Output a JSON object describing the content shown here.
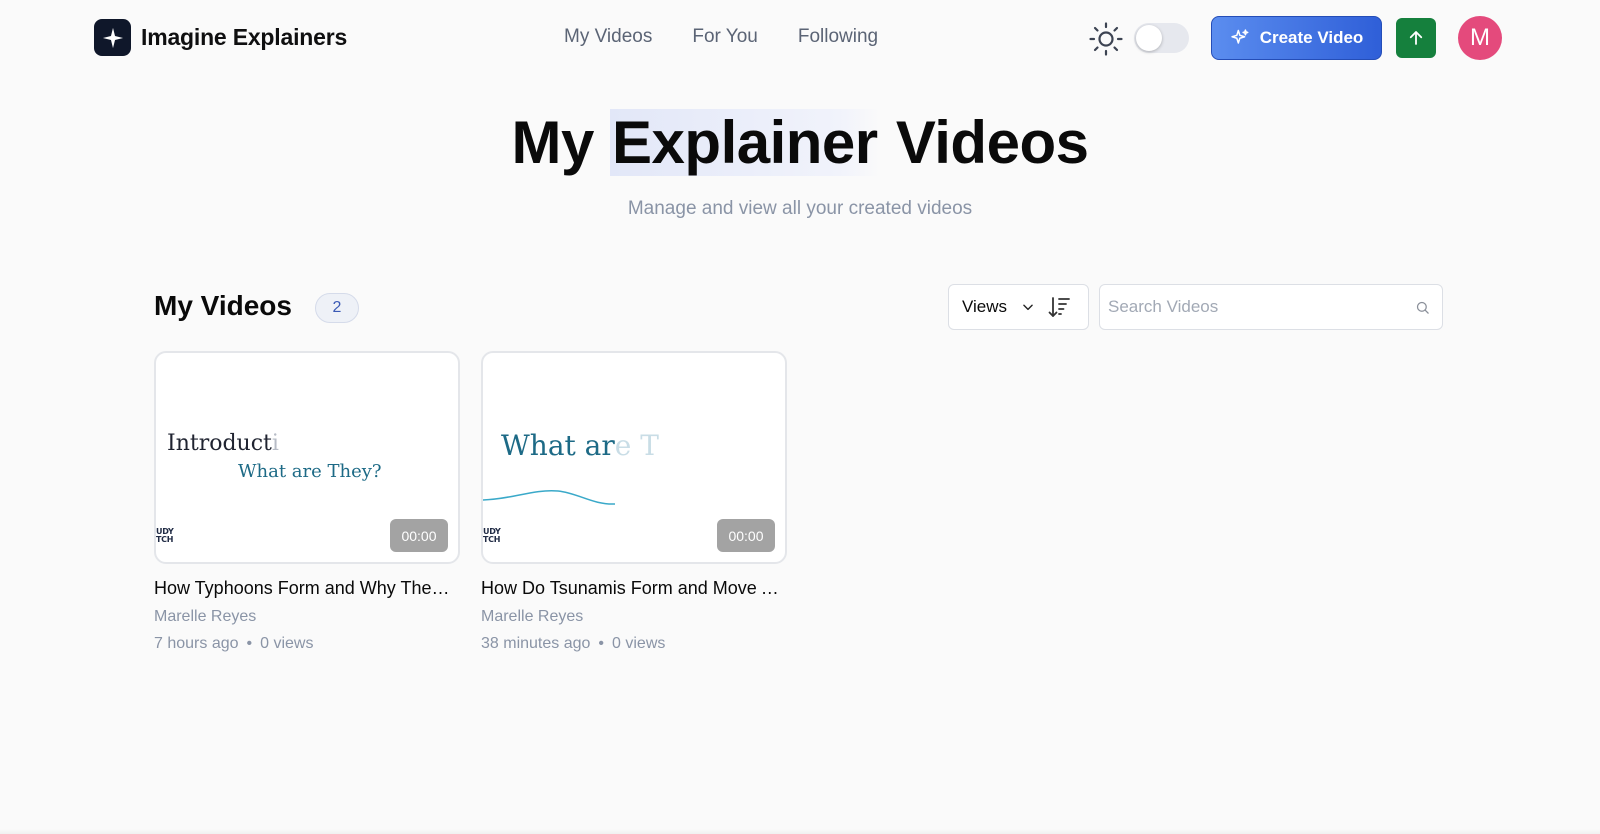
{
  "brand": {
    "name": "Imagine Explainers",
    "logo": "sparkle-icon"
  },
  "nav": {
    "items": [
      {
        "label": "My Videos"
      },
      {
        "label": "For You"
      },
      {
        "label": "Following"
      }
    ]
  },
  "header": {
    "theme_icon": "sun-icon",
    "toggle_on": false,
    "create_label": "Create Video",
    "create_icon": "sparkles-icon",
    "upload_icon": "arrow-up-icon",
    "avatar_initial": "M",
    "colors": {
      "create_button": "#3b6fe0",
      "upload_button": "#15803d",
      "avatar": "#e44a7c"
    }
  },
  "hero": {
    "title_pre": "My ",
    "title_highlight": "Explainer",
    "title_post": " Videos",
    "subtitle": "Manage and view all your created videos"
  },
  "section": {
    "title": "My Videos",
    "count": "2"
  },
  "sort": {
    "selected": "Views",
    "sort_icon": "sort-descending-icon"
  },
  "search": {
    "placeholder": "Search Videos",
    "value": ""
  },
  "videos": [
    {
      "thumb_line1": "Introducti",
      "thumb_line1_fade": "i",
      "thumb_line2": "What are They?",
      "logo_line1": "UDY",
      "logo_line2": "TCH",
      "duration": "00:00",
      "title": "How Typhoons Form and Why They Are Dangerous",
      "author": "Marelle Reyes",
      "time": "7 hours ago",
      "views": "0 views"
    },
    {
      "thumb_line1": "What ar",
      "thumb_line1_fade": "e T",
      "logo_line1": "UDY",
      "logo_line2": "TCH",
      "duration": "00:00",
      "title": "How Do Tsunamis Form and Move Across Oceans",
      "author": "Marelle Reyes",
      "time": "38 minutes ago",
      "views": "0 views"
    }
  ]
}
